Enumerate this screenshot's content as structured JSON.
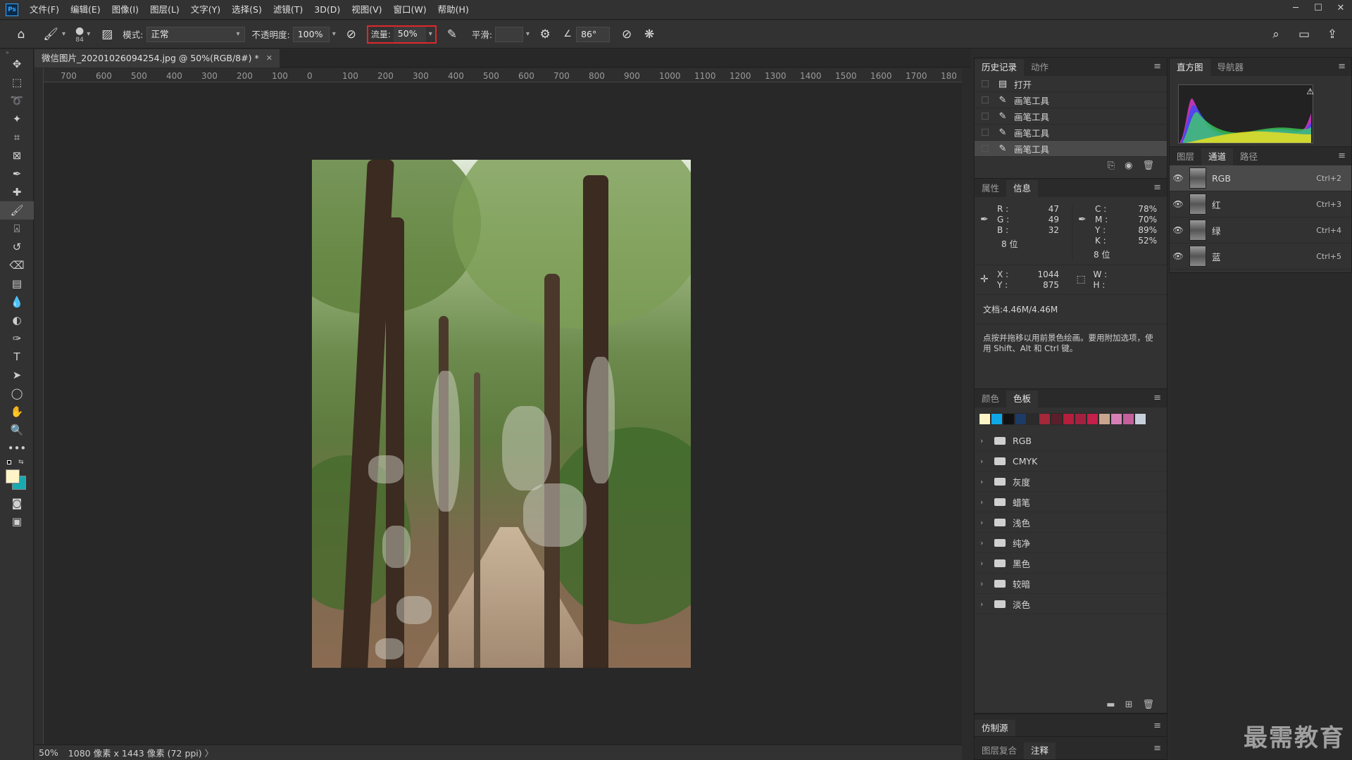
{
  "menubar": {
    "items": [
      "文件(F)",
      "编辑(E)",
      "图像(I)",
      "图层(L)",
      "文字(Y)",
      "选择(S)",
      "滤镜(T)",
      "3D(D)",
      "视图(V)",
      "窗口(W)",
      "帮助(H)"
    ]
  },
  "options": {
    "brush_size": "84",
    "mode_label": "模式:",
    "mode_value": "正常",
    "opacity_label": "不透明度:",
    "opacity_value": "100%",
    "flow_label": "流量:",
    "flow_value": "50%",
    "smooth_label": "平滑:",
    "smooth_value": "",
    "angle_value": "86°"
  },
  "document": {
    "tab_title": "微信图片_20201026094254.jpg @ 50%(RGB/8#) *",
    "ruler_ticks": [
      "700",
      "600",
      "500",
      "400",
      "300",
      "200",
      "100",
      "0",
      "100",
      "200",
      "300",
      "400",
      "500",
      "600",
      "700",
      "800",
      "900",
      "1000",
      "1100",
      "1200",
      "1300",
      "1400",
      "1500",
      "1600",
      "1700",
      "180"
    ]
  },
  "status": {
    "zoom": "50%",
    "size": "1080 像素 x 1443 像素 (72 ppi)"
  },
  "history": {
    "tabs": [
      "历史记录",
      "动作"
    ],
    "items": [
      {
        "label": "打开",
        "icon": "document-icon",
        "selected": false
      },
      {
        "label": "画笔工具",
        "icon": "brush-icon",
        "selected": false
      },
      {
        "label": "画笔工具",
        "icon": "brush-icon",
        "selected": false
      },
      {
        "label": "画笔工具",
        "icon": "brush-icon",
        "selected": false
      },
      {
        "label": "画笔工具",
        "icon": "brush-icon",
        "selected": true
      }
    ]
  },
  "info": {
    "tabs": [
      "属性",
      "信息"
    ],
    "rgb": {
      "R": "47",
      "G": "49",
      "B": "32"
    },
    "cmyk": {
      "C": "78%",
      "M": "70%",
      "Y": "89%",
      "K": "52%"
    },
    "bits_left": "8 位",
    "bits_right": "8 位",
    "x": "1044",
    "y": "875",
    "w": "",
    "h": "",
    "doc_size": "文档:4.46M/4.46M",
    "hint": "点按并拖移以用前景色绘画。要用附加选项，使用 Shift、Alt 和 Ctrl 键。"
  },
  "swatches": {
    "tabs": [
      "颜色",
      "色板"
    ],
    "colors": [
      "#fff4c8",
      "#0fa7e6",
      "#111111",
      "#1c3b66",
      "#2b2b2b",
      "#a2283a",
      "#5a1f2a",
      "#b51e3c",
      "#a3213f",
      "#c21f4a",
      "#c9a58f",
      "#d57fb6",
      "#c4609c",
      "#c8cfdc"
    ],
    "folders": [
      "RGB",
      "CMYK",
      "灰度",
      "蜡笔",
      "浅色",
      "纯净",
      "黑色",
      "较暗",
      "淡色"
    ]
  },
  "clone_source": {
    "title": "仿制源"
  },
  "layer_comps": {
    "tabs": [
      "图层复合",
      "注释"
    ]
  },
  "histogram": {
    "tabs": [
      "直方图",
      "导航器"
    ]
  },
  "channels": {
    "tabs": [
      "图层",
      "通道",
      "路径"
    ],
    "items": [
      {
        "name": "RGB",
        "key": "Ctrl+2",
        "selected": true
      },
      {
        "name": "红",
        "key": "Ctrl+3",
        "selected": false
      },
      {
        "name": "绿",
        "key": "Ctrl+4",
        "selected": false
      },
      {
        "name": "蓝",
        "key": "Ctrl+5",
        "selected": false
      }
    ]
  },
  "watermark": "最需教育",
  "colors": {
    "accent": "#31a8ff",
    "highlight_box": "#e0262b",
    "panel_bg": "#323232"
  }
}
